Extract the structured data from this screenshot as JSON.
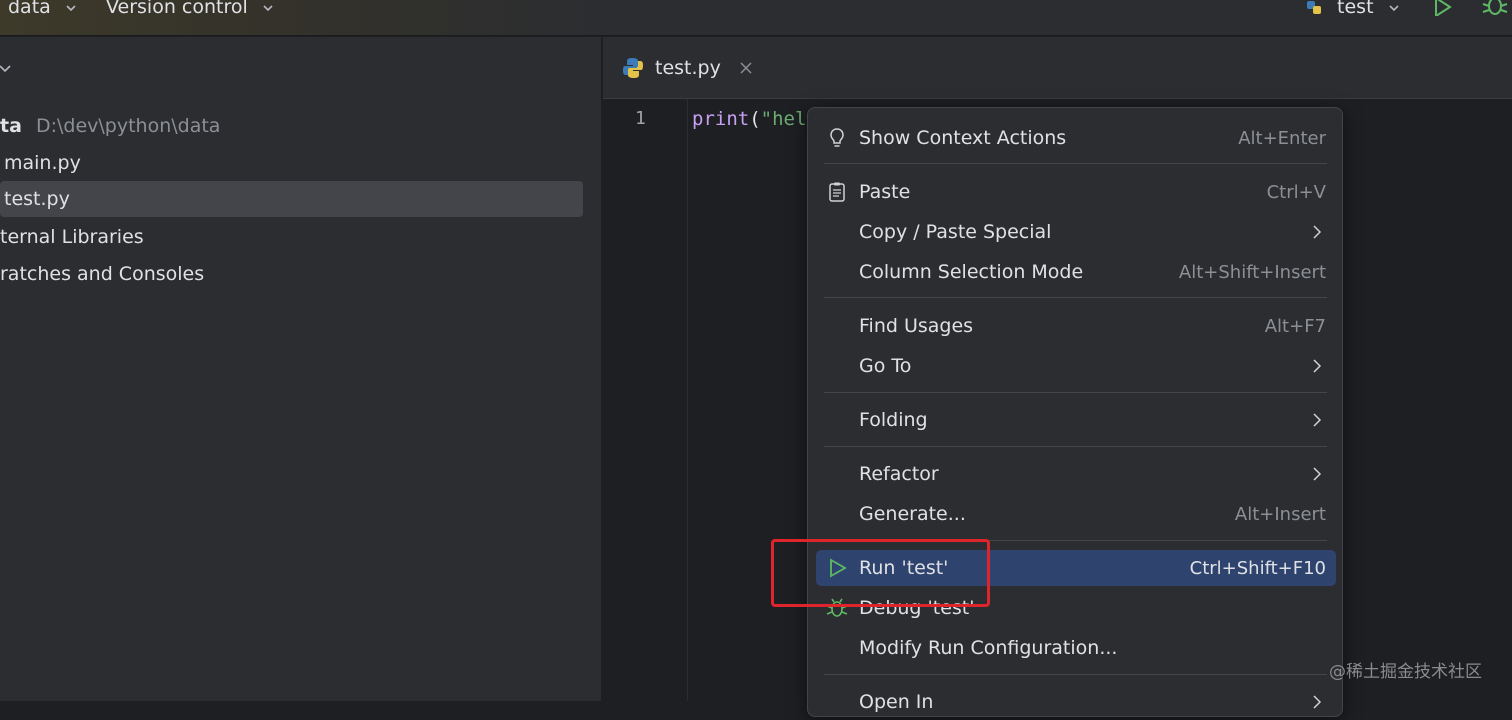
{
  "titlebar": {
    "project": "data",
    "vcs": "Version control",
    "run_config": "test",
    "icons": [
      "python-icon",
      "chevron-down-icon",
      "run-icon",
      "debug-icon"
    ]
  },
  "project_tree": {
    "root_name": "ta",
    "root_path": "D:\\dev\\python\\data",
    "items": [
      {
        "label": "main.py"
      },
      {
        "label": "test.py",
        "selected": true
      },
      {
        "label": "ternal Libraries"
      },
      {
        "label": "ratches and Consoles"
      }
    ]
  },
  "editor": {
    "tab": {
      "label": "test.py"
    },
    "line_numbers": [
      "1"
    ],
    "code": {
      "fn": "print",
      "paren": "(",
      "str": "\"hel"
    }
  },
  "context_menu": {
    "items": [
      {
        "label": "Show Context Actions",
        "shortcut": "Alt+Enter",
        "icon": "lightbulb-icon"
      },
      {
        "label": "Paste",
        "shortcut": "Ctrl+V",
        "icon": "clipboard-icon"
      },
      {
        "label": "Copy / Paste Special",
        "submenu": true
      },
      {
        "label": "Column Selection Mode",
        "shortcut": "Alt+Shift+Insert"
      },
      {
        "label": "Find Usages",
        "shortcut": "Alt+F7"
      },
      {
        "label": "Go To",
        "submenu": true
      },
      {
        "label": "Folding",
        "submenu": true
      },
      {
        "label": "Refactor",
        "submenu": true
      },
      {
        "label": "Generate...",
        "shortcut": "Alt+Insert"
      },
      {
        "label": "Run 'test'",
        "shortcut": "Ctrl+Shift+F10",
        "icon": "run-icon",
        "highlighted": true
      },
      {
        "label": "Debug 'test'",
        "icon": "debug-icon"
      },
      {
        "label": "Modify Run Configuration..."
      },
      {
        "label": "Open In",
        "submenu": true
      }
    ]
  },
  "colors": {
    "highlight": "#2e436e",
    "annotation_box": "#e0242c",
    "run_green": "#5fb865"
  },
  "watermark": "@稀土掘金技术社区"
}
